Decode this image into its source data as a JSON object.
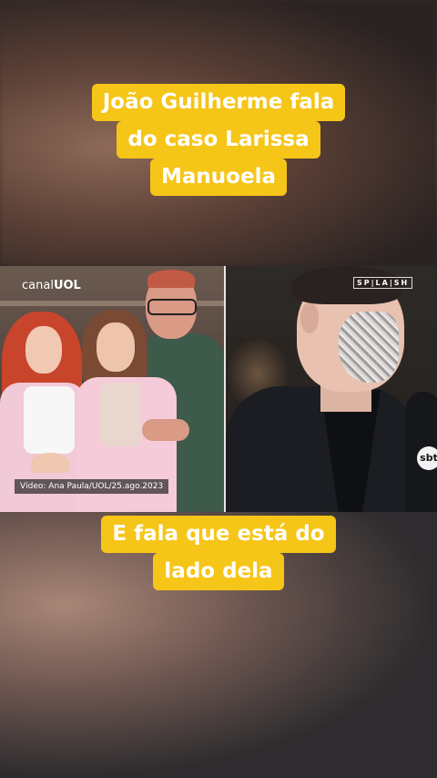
{
  "caption_top": {
    "lines": [
      "João Guilherme fala",
      "do caso Larissa",
      "Manuoela"
    ]
  },
  "caption_bottom": {
    "lines": [
      "E fala que está do",
      "lado dela"
    ]
  },
  "left_panel": {
    "logo_prefix": "canal",
    "logo_brand": "UOL",
    "credit": "Vídeo: Ana Paula/UOL/25.ago.2023"
  },
  "right_panel": {
    "watermark": "SP|LA|SH",
    "mic_logo": "sbt"
  },
  "colors": {
    "caption_bg": "#f5c518",
    "caption_text": "#ffffff"
  }
}
